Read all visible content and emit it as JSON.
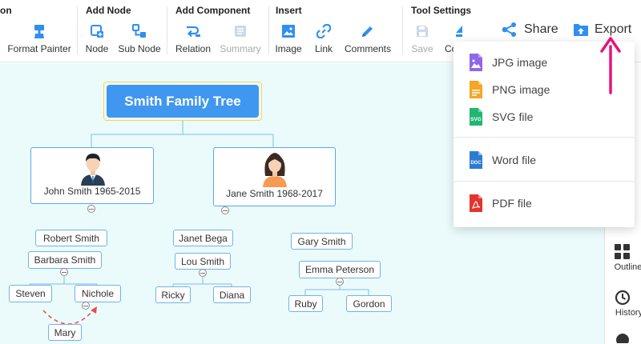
{
  "toolbar": {
    "groups": {
      "g0": "on",
      "add_node": "Add Node",
      "add_component": "Add Component",
      "insert": "Insert",
      "tool_settings": "Tool Settings"
    },
    "tools": {
      "format_painter": "Format Painter",
      "node": "Node",
      "sub_node": "Sub Node",
      "relation": "Relation",
      "summary": "Summary",
      "image": "Image",
      "link": "Link",
      "comments": "Comments",
      "save": "Save",
      "co": "Co"
    },
    "share": "Share",
    "export": "Export"
  },
  "colors": {
    "accent": "#2f8ff0",
    "root_fill": "#4097ef",
    "root_border": "#ffd24a",
    "canvas_bg": "#ebfbfb",
    "arrow": "#e8137a"
  },
  "export_menu": {
    "items": [
      {
        "label": "JPG image",
        "icon": "jpg-file-icon"
      },
      {
        "label": "PNG image",
        "icon": "png-file-icon"
      },
      {
        "label": "SVG file",
        "icon": "svg-file-icon",
        "badge": "SVG"
      },
      {
        "label": "Word file",
        "icon": "word-file-icon",
        "badge": "DOC"
      },
      {
        "label": "PDF file",
        "icon": "pdf-file-icon"
      }
    ]
  },
  "mindmap": {
    "root": "Smith Family Tree",
    "father": "John Smith 1965-2015",
    "mother": "Jane Smith 1968-2017",
    "robert": "Robert Smith",
    "barbara": "Barbara Smith",
    "steven": "Steven",
    "nichole": "Nichole",
    "mary": "Mary",
    "janet": "Janet Bega",
    "lou": "Lou Smith",
    "ricky": "Ricky",
    "diana": "Diana",
    "gary": "Gary Smith",
    "emma": "Emma Peterson",
    "ruby": "Ruby",
    "gordon": "Gordon"
  },
  "right_panel": {
    "icon": "Icon",
    "outline": "Outline",
    "history": "History"
  }
}
